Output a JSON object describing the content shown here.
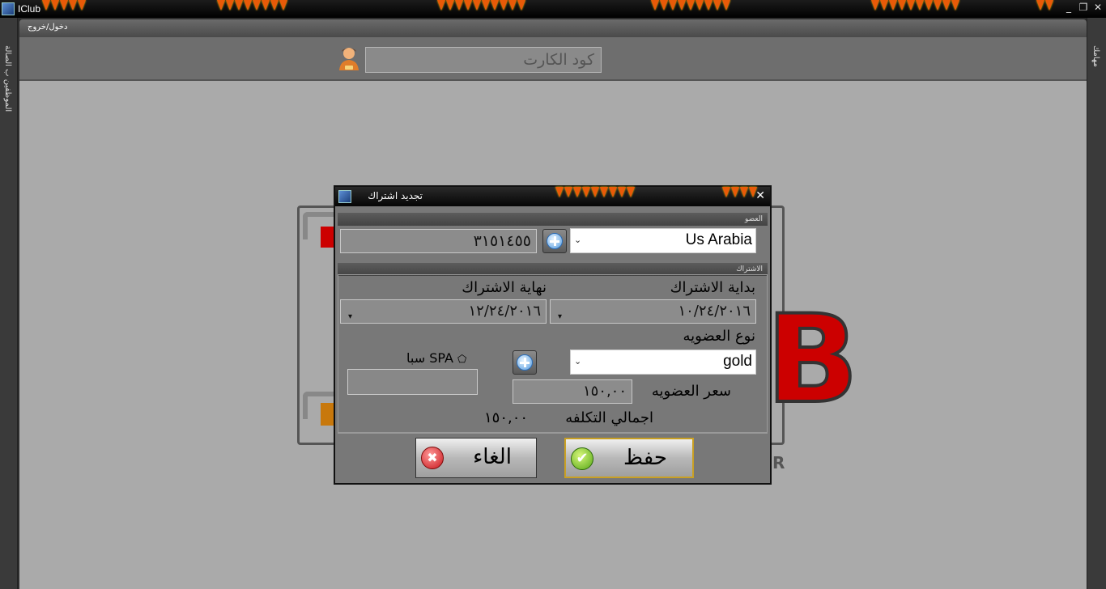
{
  "window": {
    "title": "IClub"
  },
  "window_controls": {
    "minimize": "_",
    "maximize": "❐",
    "close": "✕"
  },
  "tab": {
    "label": "دخول/خروج"
  },
  "side_left": {
    "label": "الموظفين ب الصالة"
  },
  "side_right": {
    "label": "مهامك"
  },
  "header": {
    "card_code_placeholder": "كود الكارت"
  },
  "dialog": {
    "title": "تجديد اشتراك",
    "member_section": "العضو",
    "member_name": "Us Arabia",
    "member_code": "٣١٥١٤٥٥",
    "subscription_section": "الاشتراك",
    "start_label": "بداية الاشتراك",
    "end_label": "نهاية الاشتراك",
    "start_date": "١٠/٢٤/٢٠١٦",
    "end_date": "١٢/٢٤/٢٠١٦",
    "membership_type_label": "نوع العضويه",
    "membership_type": "gold",
    "spa_label": "سبا SPA",
    "price_label": "سعر العضويه",
    "price_value": "١٥٠,٠٠",
    "total_label": "اجمالي التكلفه",
    "total_value": "١٥٠,٠٠",
    "cancel_label": "الغاء",
    "save_label": "حفظ"
  },
  "background": {
    "logo_letter": "B",
    "logo_letter_small": "R"
  },
  "colors": {
    "accent_red": "#cc0000",
    "flame": "#e85a08",
    "save_green": "#56a816"
  }
}
